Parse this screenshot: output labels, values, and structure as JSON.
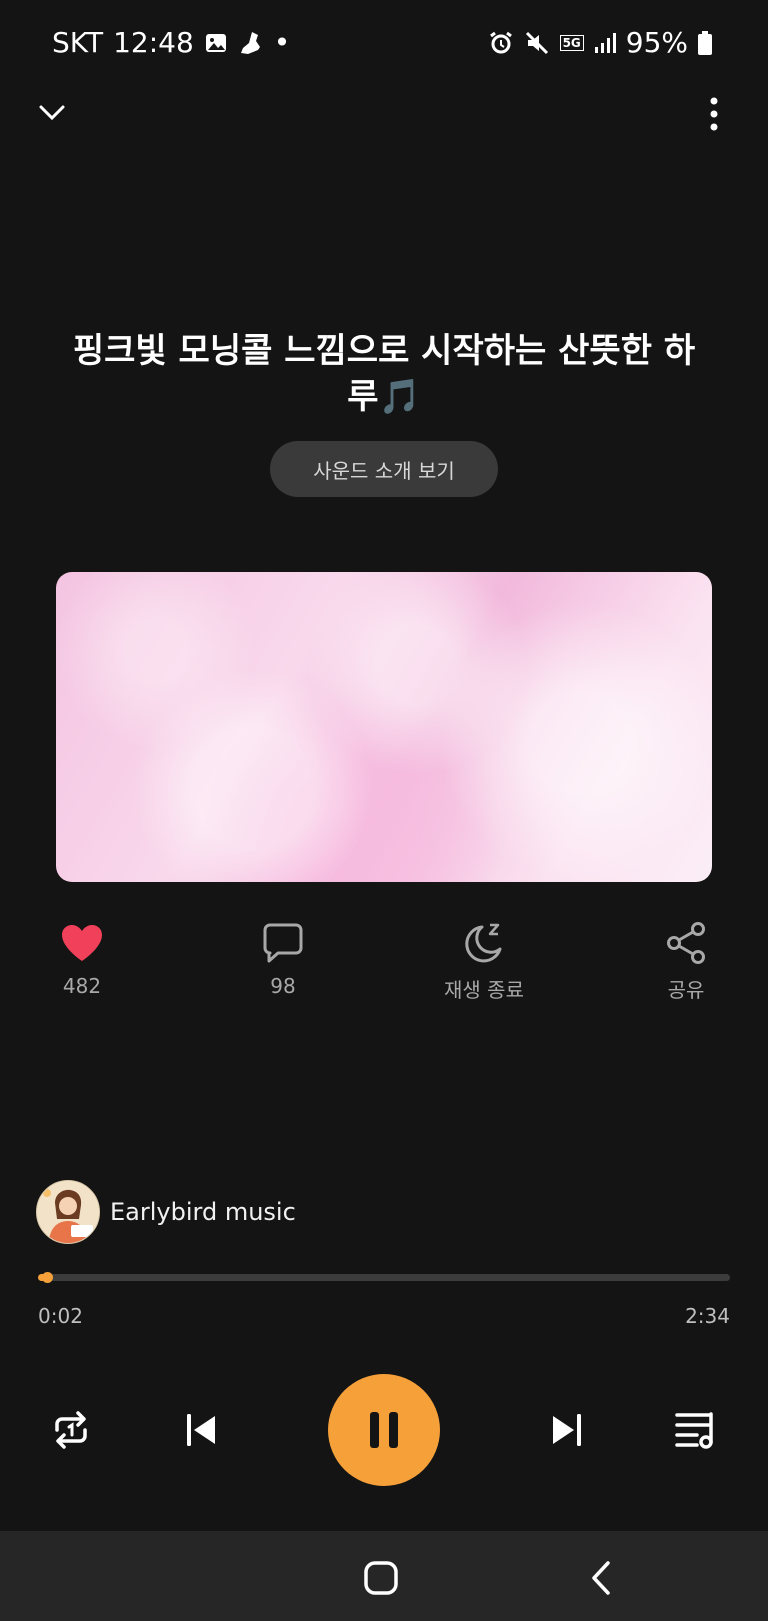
{
  "status_bar": {
    "carrier": "SKT",
    "time": "12:48",
    "dot": "•",
    "network": "5G",
    "battery": "95%"
  },
  "header": {
    "collapse_icon": "chevron-down-icon",
    "more_icon": "more-vertical-icon"
  },
  "title": "핑크빛 모닝콜 느낌으로 시작하는 산뜻한 하루🎵",
  "intro_button": "사운드 소개 보기",
  "actions": {
    "likes": "482",
    "comments": "98",
    "sleep_timer": "재생 종료",
    "share": "공유"
  },
  "artist": {
    "name": "Earlybird music"
  },
  "player": {
    "current_time": "0:02",
    "total_time": "2:34",
    "progress": 0.013,
    "accent_color": "#f6a03a"
  },
  "controls": {
    "repeat_icon": "repeat-one-icon",
    "prev_icon": "skip-previous-icon",
    "pause_icon": "pause-icon",
    "next_icon": "skip-next-icon",
    "queue_icon": "playlist-icon"
  }
}
